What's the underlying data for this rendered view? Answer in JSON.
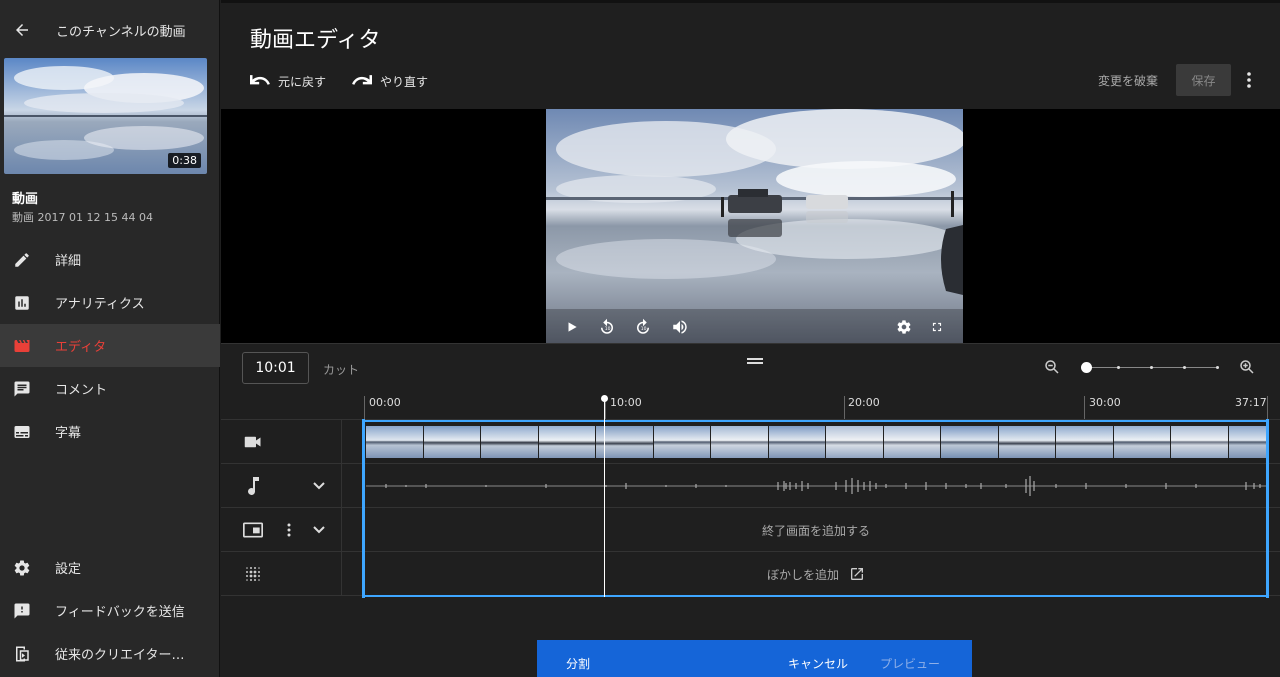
{
  "sidebar": {
    "channel_label": "このチャンネルの動画",
    "thumbnail_duration": "0:38",
    "video_title": "動画",
    "video_name": "動画 2017 01 12 15 44 04",
    "nav": [
      {
        "label": "詳細",
        "icon": "pencil-icon"
      },
      {
        "label": "アナリティクス",
        "icon": "analytics-icon"
      },
      {
        "label": "エディタ",
        "icon": "clapperboard-icon",
        "active": true
      },
      {
        "label": "コメント",
        "icon": "comment-icon"
      },
      {
        "label": "字幕",
        "icon": "subtitles-icon"
      }
    ],
    "bottom": [
      {
        "label": "設定",
        "icon": "gear-icon"
      },
      {
        "label": "フィードバックを送信",
        "icon": "feedback-icon"
      },
      {
        "label": "従来のクリエイター…",
        "icon": "classic-studio-icon"
      }
    ]
  },
  "header": {
    "title": "動画エディタ",
    "undo_label": "元に戻す",
    "redo_label": "やり直す",
    "discard_label": "変更を破棄",
    "save_label": "保存"
  },
  "timeline": {
    "current_time": "10:01",
    "cut_label": "カット",
    "ruler": [
      "00:00",
      "10:00",
      "20:00",
      "30:00",
      "37:17"
    ],
    "end_screen_label": "終了画面を追加する",
    "blur_label": "ぼかしを追加"
  },
  "footer": {
    "split_label": "分割",
    "cancel_label": "キャンセル",
    "preview_label": "プレビュー"
  },
  "colors": {
    "accent_red": "#e94038",
    "selection_blue": "#3ea6ff",
    "bar_blue": "#1565d8"
  }
}
